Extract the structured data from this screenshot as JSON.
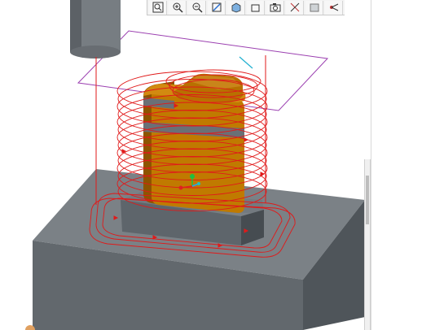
{
  "window": {
    "type": "CAM 3D viewport"
  },
  "toolbar": {
    "buttons": [
      {
        "name": "zoom-window-icon",
        "tooltip": ""
      },
      {
        "name": "zoom-in-icon",
        "tooltip": ""
      },
      {
        "name": "zoom-out-icon",
        "tooltip": ""
      },
      {
        "name": "refit-icon",
        "tooltip": ""
      },
      {
        "name": "display-style-icon",
        "tooltip": ""
      },
      {
        "name": "named-views-icon",
        "tooltip": ""
      },
      {
        "name": "screenshot-icon",
        "tooltip": ""
      },
      {
        "name": "datum-display-icon",
        "tooltip": ""
      },
      {
        "name": "shading-icon",
        "tooltip": ""
      },
      {
        "name": "spin-center-icon",
        "tooltip": ""
      }
    ]
  },
  "scene": {
    "colors": {
      "stock": "#6f767c",
      "stock_top": "#7a8186",
      "workpiece": "#c07a00",
      "workpiece_dark": "#8a5200",
      "fixture": "#5a6166",
      "tool": "#7b8085",
      "toolpath": "#e01a1a",
      "retract_plane": "#9b3fb0",
      "csys_x": "#e02020",
      "csys_y": "#20c040",
      "csys_z": "#20a0ff"
    }
  }
}
